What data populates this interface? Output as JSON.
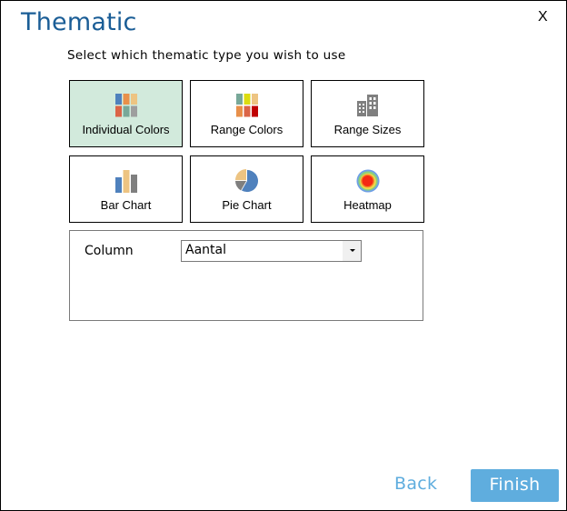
{
  "dialog": {
    "title": "Thematic",
    "close_label": "X",
    "subtitle": "Select which thematic type you wish to use"
  },
  "thematic_types": [
    {
      "label": "Individual Colors",
      "icon": "individual-colors-icon",
      "selected": true
    },
    {
      "label": "Range Colors",
      "icon": "range-colors-icon",
      "selected": false
    },
    {
      "label": "Range Sizes",
      "icon": "range-sizes-icon",
      "selected": false
    },
    {
      "label": "Bar Chart",
      "icon": "bar-chart-icon",
      "selected": false
    },
    {
      "label": "Pie Chart",
      "icon": "pie-chart-icon",
      "selected": false
    },
    {
      "label": "Heatmap",
      "icon": "heatmap-icon",
      "selected": false
    }
  ],
  "options": {
    "column_label": "Column",
    "column_value": "Aantal"
  },
  "footer": {
    "back_label": "Back",
    "finish_label": "Finish"
  },
  "colors": {
    "title": "#1a5d96",
    "accent": "#5fadde",
    "selected_tile": "#d2eadc"
  }
}
